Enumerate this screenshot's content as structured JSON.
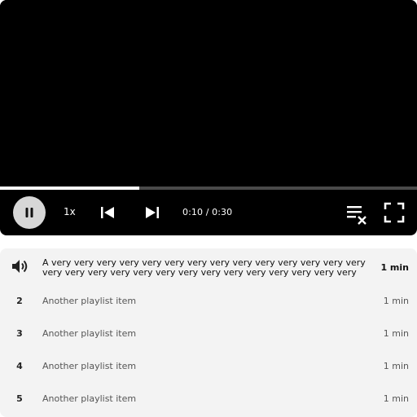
{
  "player": {
    "progress_fraction": 0.3333,
    "speed_label": "1x",
    "time_current": "0:10",
    "time_separator": " / ",
    "time_total": "0:30",
    "play_state": "playing",
    "icons": {
      "play_pause": "pause-icon",
      "previous": "skip-previous-icon",
      "next": "skip-next-icon",
      "clear_queue": "playlist-remove-icon",
      "fullscreen": "fullscreen-icon"
    }
  },
  "playlist": {
    "items": [
      {
        "index": "",
        "icon": "speaker-icon",
        "title": "A very very very very very very very very very very very very very very very very very very very very very very very very very very very very very very very very very very very very very very…",
        "duration": "1 min",
        "active": true
      },
      {
        "index": "2",
        "title": "Another playlist item",
        "duration": "1 min",
        "active": false
      },
      {
        "index": "3",
        "title": "Another playlist item",
        "duration": "1 min",
        "active": false
      },
      {
        "index": "4",
        "title": "Another playlist item",
        "duration": "1 min",
        "active": false
      },
      {
        "index": "5",
        "title": "Another playlist item",
        "duration": "1 min",
        "active": false
      }
    ]
  },
  "colors": {
    "player_bg": "#000000",
    "progress_fill": "#ffffff",
    "progress_track": "#4a4a4a",
    "play_button_bg": "#d7d7d7",
    "playlist_bg": "#f3f3f3"
  }
}
